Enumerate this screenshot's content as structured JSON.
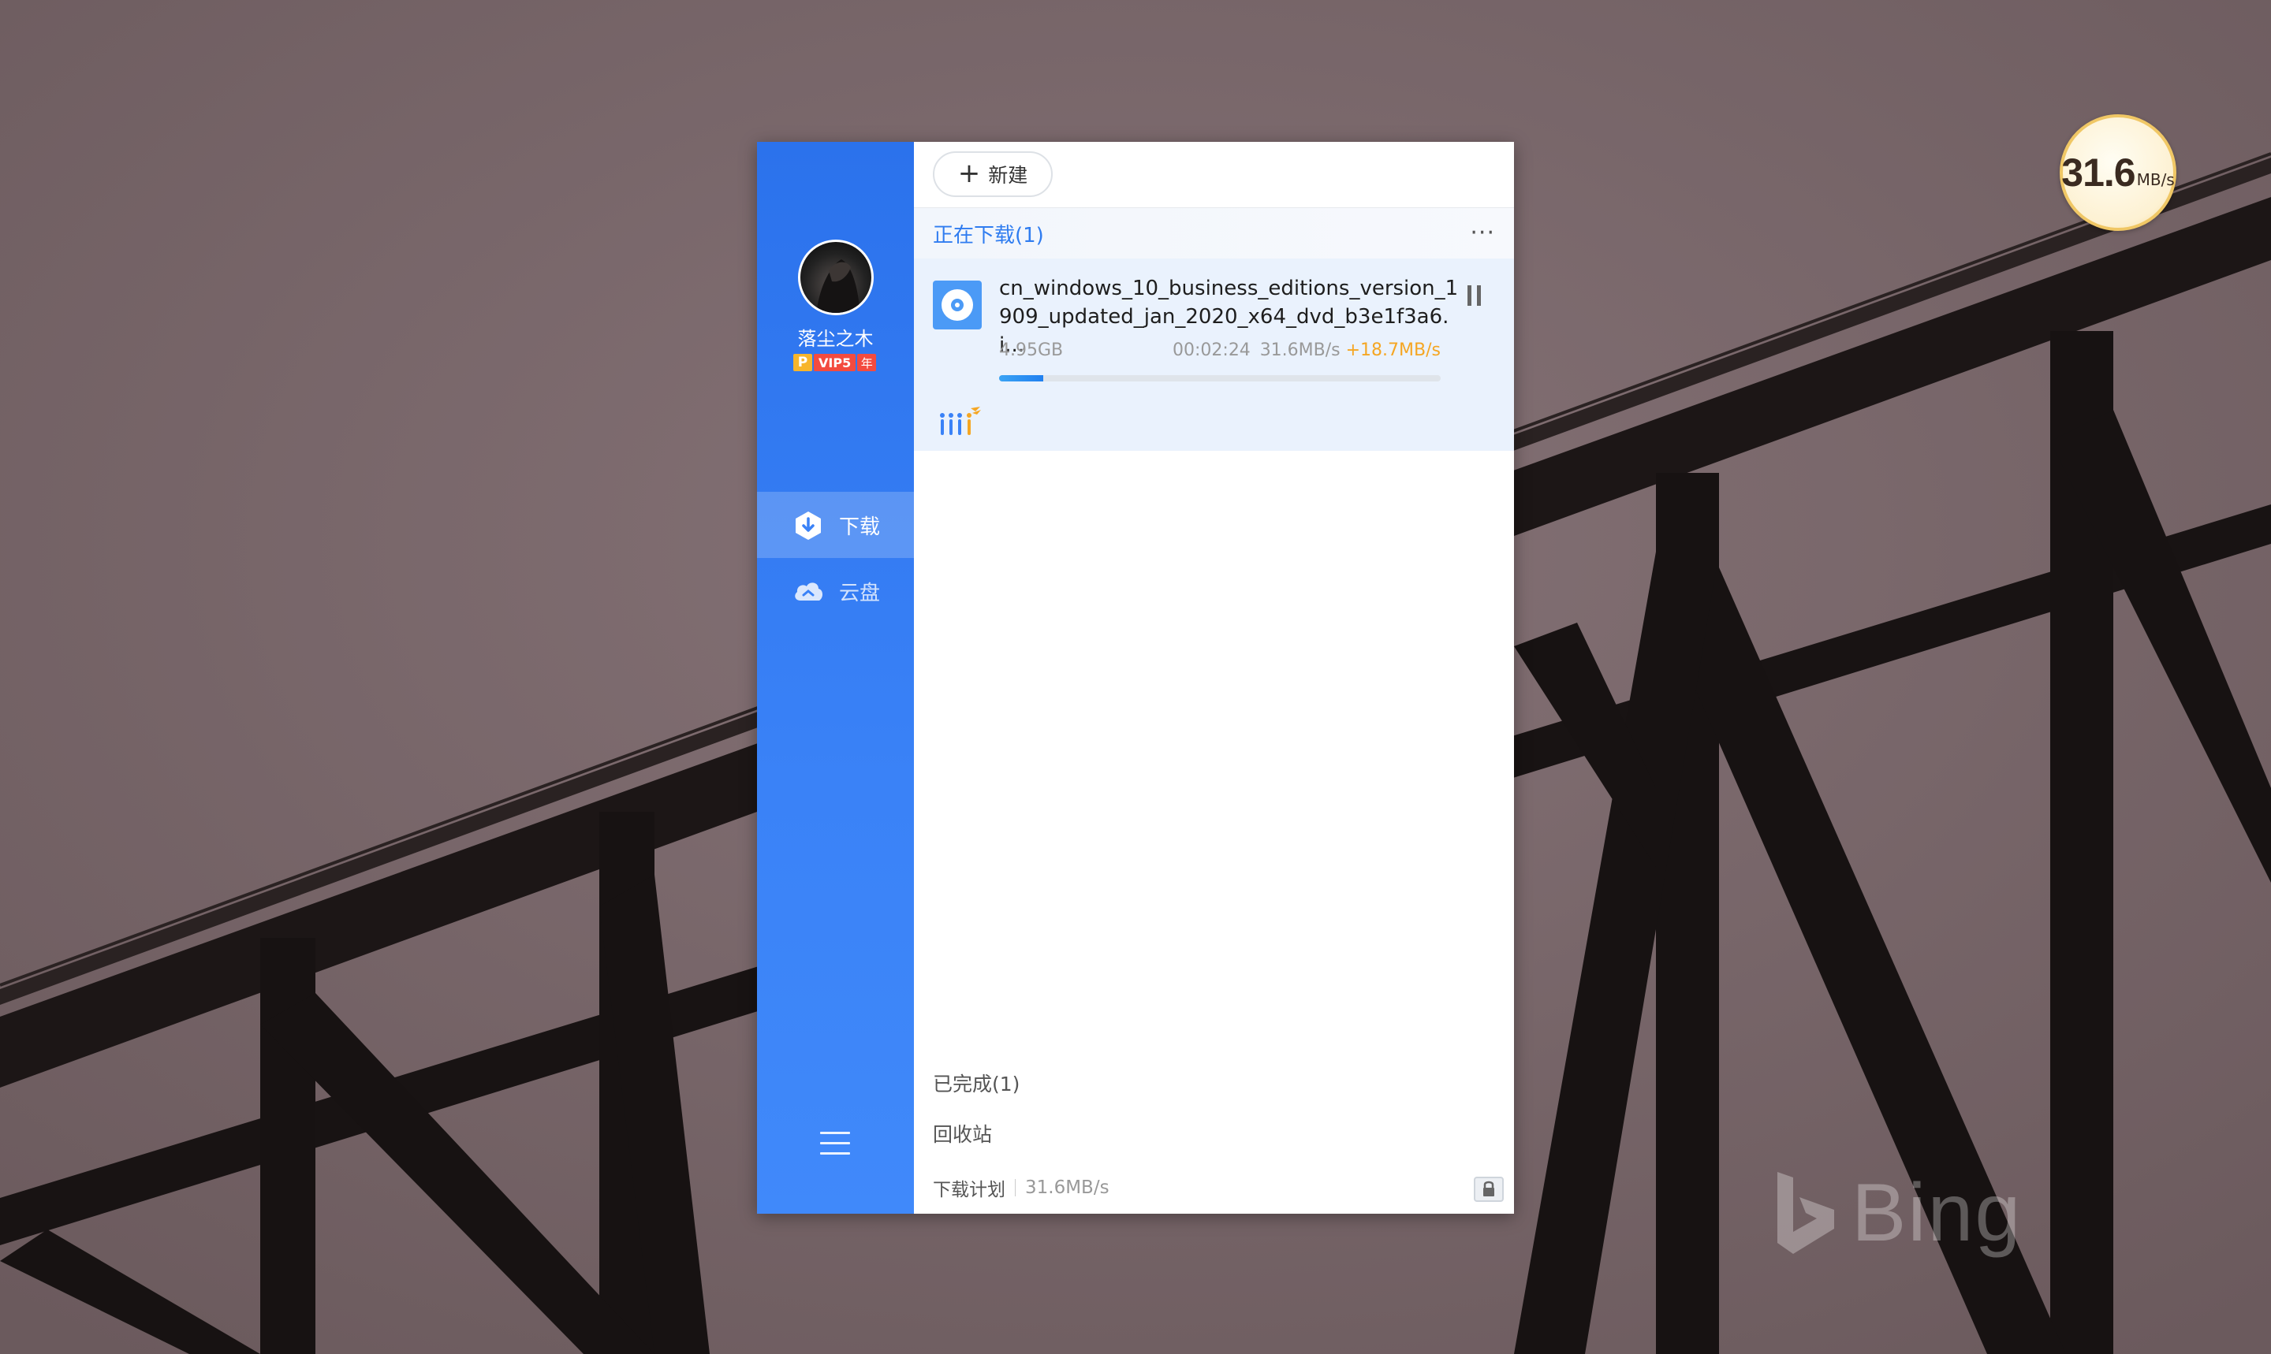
{
  "wallpaper": {
    "watermark": "Bing"
  },
  "speed_ball": {
    "value": "31.6",
    "unit": "MB/s"
  },
  "sidebar": {
    "username": "落尘之木",
    "vip": {
      "p": "P",
      "level": "VIP5",
      "year": "年"
    },
    "nav": [
      {
        "label": "下载",
        "icon": "download-icon",
        "active": true
      },
      {
        "label": "云盘",
        "icon": "cloud-icon",
        "active": false
      }
    ],
    "menu_icon": "hamburger-menu-icon"
  },
  "toolbar": {
    "new_label": "新建"
  },
  "downloading": {
    "title": "正在下载(1)",
    "more": "···",
    "tasks": [
      {
        "name": "cn_windows_10_business_editions_version_1909_updated_jan_2020_x64_dvd_b3e1f3a6.i...",
        "size": "4.95GB",
        "remaining": "00:02:24",
        "speed": "31.6MB/s",
        "boost": "+18.7MB/s",
        "progress": 0.1,
        "icon": "disc-icon"
      }
    ]
  },
  "completed": {
    "label": "已完成(1)"
  },
  "recycle": {
    "label": "回收站"
  },
  "plan": {
    "label": "下载计划",
    "speed": "31.6MB/s"
  },
  "colors": {
    "accent": "#2f7cf0",
    "sidebar": "#3a82f7",
    "boost": "#f5a623"
  }
}
